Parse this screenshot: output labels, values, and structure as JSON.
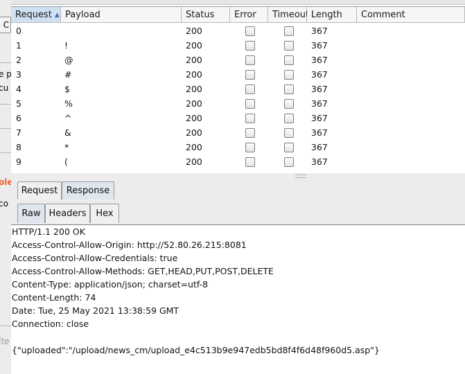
{
  "background_window": {
    "fragments": [
      "C",
      "e p",
      "cu",
      "ole",
      "co",
      "ite"
    ]
  },
  "table": {
    "columns": [
      "Request",
      "Payload",
      "Status",
      "Error",
      "Timeout",
      "Length",
      "Comment"
    ],
    "sort_indicator": "▲",
    "rows": [
      {
        "request": "0",
        "payload": "",
        "status": "200",
        "error": false,
        "timeout": false,
        "length": "367",
        "comment": ""
      },
      {
        "request": "1",
        "payload": "!",
        "status": "200",
        "error": false,
        "timeout": false,
        "length": "367",
        "comment": ""
      },
      {
        "request": "2",
        "payload": "@",
        "status": "200",
        "error": false,
        "timeout": false,
        "length": "367",
        "comment": ""
      },
      {
        "request": "3",
        "payload": "#",
        "status": "200",
        "error": false,
        "timeout": false,
        "length": "367",
        "comment": ""
      },
      {
        "request": "4",
        "payload": "$",
        "status": "200",
        "error": false,
        "timeout": false,
        "length": "367",
        "comment": ""
      },
      {
        "request": "5",
        "payload": "%",
        "status": "200",
        "error": false,
        "timeout": false,
        "length": "367",
        "comment": ""
      },
      {
        "request": "6",
        "payload": "^",
        "status": "200",
        "error": false,
        "timeout": false,
        "length": "367",
        "comment": ""
      },
      {
        "request": "7",
        "payload": "&",
        "status": "200",
        "error": false,
        "timeout": false,
        "length": "367",
        "comment": ""
      },
      {
        "request": "8",
        "payload": "*",
        "status": "200",
        "error": false,
        "timeout": false,
        "length": "367",
        "comment": ""
      },
      {
        "request": "9",
        "payload": "(",
        "status": "200",
        "error": false,
        "timeout": false,
        "length": "367",
        "comment": ""
      }
    ]
  },
  "message_tabs": {
    "items": [
      "Request",
      "Response"
    ],
    "active": "Response"
  },
  "view_tabs": {
    "items": [
      "Raw",
      "Headers",
      "Hex"
    ],
    "active": "Raw"
  },
  "response": {
    "lines": [
      "HTTP/1.1 200 OK",
      "Access-Control-Allow-Origin: http://52.80.26.215:8081",
      "Access-Control-Allow-Credentials: true",
      "Access-Control-Allow-Methods: GET,HEAD,PUT,POST,DELETE",
      "Content-Type: application/json; charset=utf-8",
      "Content-Length: 74",
      "Date: Tue, 25 May 2021 13:38:59 GMT",
      "Connection: close",
      "",
      "{\"uploaded\":\"/upload/news_cm/upload_e4c513b9e947edb5bd8f4f6d48f960d5.asp\"}"
    ]
  },
  "colors": {
    "sorted_header": "#cfe0f3",
    "active_tab": "#dfe6ee",
    "accent_text": "#e8632b"
  }
}
